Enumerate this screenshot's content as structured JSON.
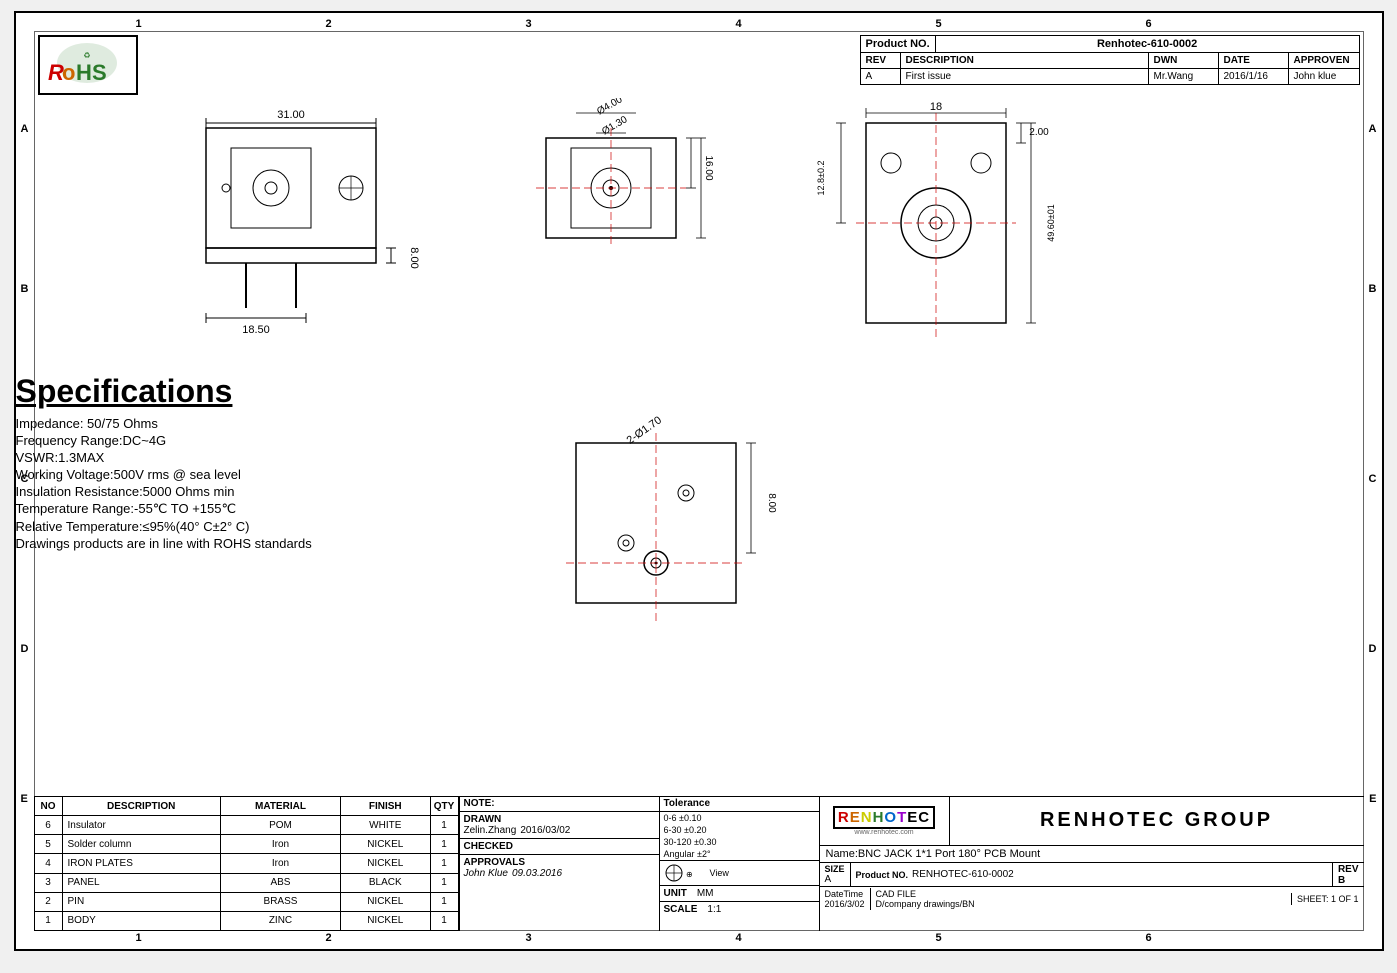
{
  "sheet": {
    "title": "RENHOTEC GROUP",
    "product_no": "Renhotec-610-0002",
    "product_no_label": "Product NO.",
    "rev_label": "REV",
    "description_label": "DESCRIPTION",
    "dwn_label": "DWN",
    "date_label": "DATE",
    "approved_label": "APPROVEN",
    "rev_value": "A",
    "description_value": "First issue",
    "dwn_value": "Mr.Wang",
    "date_value": "2016/1/16",
    "approved_value": "John klue",
    "col_markers": [
      "1",
      "2",
      "3",
      "4",
      "5",
      "6"
    ],
    "row_markers": [
      "A",
      "B",
      "C",
      "D",
      "E"
    ]
  },
  "specs": {
    "title": "Specifications",
    "items": [
      "Impedance: 50/75 Ohms",
      "Frequency Range:DC~4G",
      "VSWR:1.3MAX",
      "Working Voltage:500V rms @ sea level",
      "Insulation Resistance:5000 Ohms min",
      "Temperature Range:-55℃ TO +155℃",
      "Relative Temperature:≤95%(40° C±2° C)",
      "Drawings products are in line with ROHS standards"
    ]
  },
  "parts": {
    "headers": [
      "NO",
      "DESCRIPTION",
      "MATERIAL",
      "FINISH",
      "QTY"
    ],
    "rows": [
      [
        "6",
        "Insulator",
        "POM",
        "WHITE",
        "1"
      ],
      [
        "5",
        "Solder column",
        "Iron",
        "NICKEL",
        "1"
      ],
      [
        "4",
        "IRON PLATES",
        "Iron",
        "NICKEL",
        "1"
      ],
      [
        "3",
        "PANEL",
        "ABS",
        "BLACK",
        "1"
      ],
      [
        "2",
        "PIN",
        "BRASS",
        "NICKEL",
        "1"
      ],
      [
        "1",
        "BODY",
        "ZINC",
        "NICKEL",
        "1"
      ]
    ]
  },
  "drawing_info": {
    "drawn_label": "DRAWN",
    "drawn_value": "Zelin.Zhang",
    "drawn_date": "2016/03/02",
    "checked_label": "CHECKED",
    "approvals_label": "APPROVALS",
    "approvals_signer": "John Klue",
    "approvals_date": "09.03.2016",
    "scale_label": "SCALE",
    "scale_value": "1:1",
    "unit_label": "UNIT",
    "unit_value": "MM",
    "view_label": "View",
    "note_label": "NOTE:"
  },
  "tolerance": {
    "label": "Tolerance",
    "rows": [
      "0-6    ±0.10",
      "6-30   ±0.20",
      "30-120 ±0.30",
      "Angular ±2°"
    ]
  },
  "renhotec_info": {
    "logo_text": "RENHOTEC",
    "website": "www.renhotec.com",
    "company_name": "RENHOTEC GROUP",
    "part_name": "Name:BNC JACK 1*1 Port 180° PCB Mount",
    "size_label": "SIZE",
    "size_value": "A",
    "product_no_label": "Product NO.",
    "product_no_value": "RENHOTEC-610-0002",
    "rev_label": "REV",
    "rev_value": "B",
    "datetime_label": "DateTime",
    "datetime_value": "2016/3/02",
    "cad_file_label": "CAD FILE",
    "cad_file_value": "D/company drawings/BN",
    "sheet_label": "SHEET:",
    "sheet_value": "1 OF 1"
  },
  "dimensions": {
    "front_width": "31.00",
    "front_height": "18.50",
    "side_height": "8.00",
    "circle_d1": "Ø4.00",
    "circle_d2": "Ø1.30",
    "side_w1": "16.00",
    "side_w2": "18.00",
    "top_width": "18",
    "top_h1": "2.00",
    "top_h2": "12.8±0.2",
    "top_h3": "49.60±01",
    "bottom_pins": "2-Ø1.70",
    "bottom_h": "8.00"
  }
}
